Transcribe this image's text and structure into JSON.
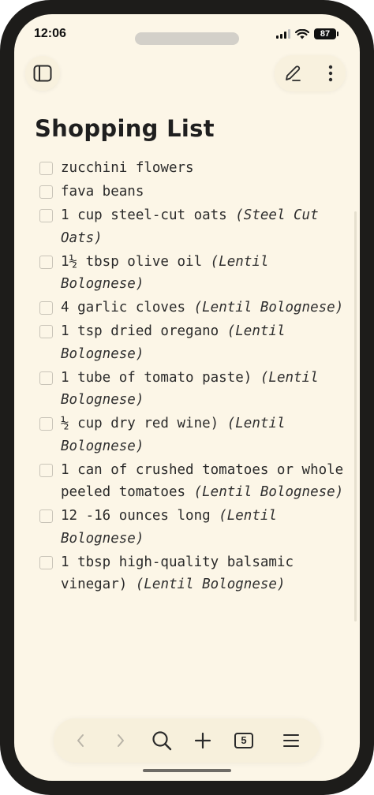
{
  "status_bar": {
    "time": "12:06",
    "battery": "87"
  },
  "header": {
    "sidebar_icon": "sidebar-toggle-icon",
    "edit_icon": "pencil-icon",
    "more_icon": "vertical-dots-icon"
  },
  "note": {
    "title": "Shopping List",
    "items": [
      {
        "text": "zucchini flowers",
        "source": ""
      },
      {
        "text": "fava beans",
        "source": ""
      },
      {
        "text": "1 cup steel-cut oats",
        "source": "(Steel Cut Oats)"
      },
      {
        "text": "1½ tbsp olive oil",
        "source": "(Lentil Bolognese)"
      },
      {
        "text": "4 garlic cloves",
        "source": "(Lentil Bolognese)"
      },
      {
        "text": "1 tsp dried oregano",
        "source": "(Lentil Bolognese)"
      },
      {
        "text": "1 tube of tomato paste)",
        "source": "(Lentil Bolognese)"
      },
      {
        "text": "½ cup dry red wine)",
        "source": "(Lentil Bolognese)"
      },
      {
        "text": "1 can of crushed tomatoes or whole peeled tomatoes",
        "source": "(Lentil Bolognese)"
      },
      {
        "text": "12 -16 ounces long",
        "source": "(Lentil Bolognese)"
      },
      {
        "text": "1 tbsp high-quality balsamic vinegar)",
        "source": "(Lentil Bolognese)"
      }
    ]
  },
  "bottom_nav": {
    "back_icon": "chevron-left-icon",
    "forward_icon": "chevron-right-icon",
    "search_icon": "search-icon",
    "add_icon": "plus-icon",
    "tab_count": "5",
    "menu_icon": "hamburger-icon"
  }
}
